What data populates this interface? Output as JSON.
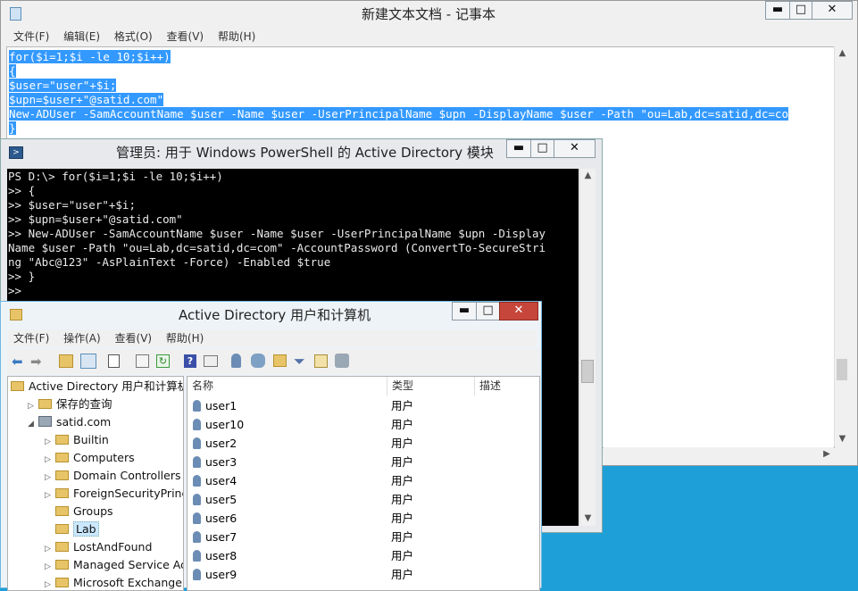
{
  "notepad": {
    "title": "新建文本文档 - 记事本",
    "menu": [
      "文件(F)",
      "编辑(E)",
      "格式(O)",
      "查看(V)",
      "帮助(H)"
    ],
    "lines": [
      "for($i=1;$i -le 10;$i++)",
      "{",
      "$user=\"user\"+$i;",
      "$upn=$user+\"@satid.com\"",
      "New-ADUser -SamAccountName $user -Name $user -UserPrincipalName $upn -DisplayName $user -Path \"ou=Lab,dc=satid,dc=co",
      "}"
    ]
  },
  "powershell": {
    "title": "管理员: 用于 Windows PowerShell 的 Active Directory 模块",
    "lines": [
      "PS D:\\> for($i=1;$i -le 10;$i++)",
      ">> {",
      ">> $user=\"user\"+$i;",
      ">> $upn=$user+\"@satid.com\"",
      ">> New-ADUser -SamAccountName $user -Name $user -UserPrincipalName $upn -Display",
      "Name $user -Path \"ou=Lab,dc=satid,dc=com\" -AccountPassword (ConvertTo-SecureStri",
      "ng \"Abc@123\" -AsPlainText -Force) -Enabled $true",
      ">> }",
      ">>"
    ]
  },
  "aduc": {
    "title": "Active Directory 用户和计算机",
    "menu": [
      "文件(F)",
      "操作(A)",
      "查看(V)",
      "帮助(H)"
    ],
    "tree": [
      {
        "label": "Active Directory 用户和计算机",
        "indent": 0,
        "toggle": "",
        "icon": "aduc-icon"
      },
      {
        "label": "保存的查询",
        "indent": 1,
        "toggle": "▷",
        "icon": "folder-icon"
      },
      {
        "label": "satid.com",
        "indent": 1,
        "toggle": "◢",
        "icon": "domain-icon"
      },
      {
        "label": "Builtin",
        "indent": 2,
        "toggle": "▷",
        "icon": "folder-icon"
      },
      {
        "label": "Computers",
        "indent": 2,
        "toggle": "▷",
        "icon": "folder-icon"
      },
      {
        "label": "Domain Controllers",
        "indent": 2,
        "toggle": "▷",
        "icon": "ou-icon"
      },
      {
        "label": "ForeignSecurityPrincipa",
        "indent": 2,
        "toggle": "▷",
        "icon": "folder-icon"
      },
      {
        "label": "Groups",
        "indent": 2,
        "toggle": "",
        "icon": "ou-icon"
      },
      {
        "label": "Lab",
        "indent": 2,
        "toggle": "",
        "icon": "ou-icon",
        "selected": true
      },
      {
        "label": "LostAndFound",
        "indent": 2,
        "toggle": "▷",
        "icon": "folder-icon"
      },
      {
        "label": "Managed Service Acco",
        "indent": 2,
        "toggle": "▷",
        "icon": "folder-icon"
      },
      {
        "label": "Microsoft Exchange Se",
        "indent": 2,
        "toggle": "▷",
        "icon": "ou-icon"
      }
    ],
    "columns": [
      "名称",
      "类型",
      "描述"
    ],
    "rows": [
      {
        "name": "user1",
        "type": "用户"
      },
      {
        "name": "user10",
        "type": "用户"
      },
      {
        "name": "user2",
        "type": "用户"
      },
      {
        "name": "user3",
        "type": "用户"
      },
      {
        "name": "user4",
        "type": "用户"
      },
      {
        "name": "user5",
        "type": "用户"
      },
      {
        "name": "user6",
        "type": "用户"
      },
      {
        "name": "user7",
        "type": "用户"
      },
      {
        "name": "user8",
        "type": "用户"
      },
      {
        "name": "user9",
        "type": "用户"
      }
    ]
  },
  "window_controls": {
    "minimize": "▬",
    "maximize": "□",
    "close": "✕"
  }
}
